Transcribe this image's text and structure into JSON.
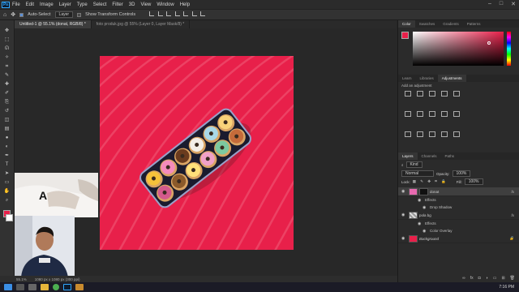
{
  "menubar": {
    "logo": "Ps",
    "items": [
      "File",
      "Edit",
      "Image",
      "Layer",
      "Type",
      "Select",
      "Filter",
      "3D",
      "View",
      "Window",
      "Help"
    ],
    "window_controls": [
      "–",
      "□",
      "✕"
    ]
  },
  "options": {
    "auto_select_label": "Auto-Select",
    "auto_select_value": "Layer",
    "transform_label": "Show Transform Controls"
  },
  "tabs": [
    {
      "label": "Untitled-1 @ 55.1% (donat, RGB/8) *",
      "active": true
    },
    {
      "label": "foto produk.jpg @ 55% (Layer 0, Layer Mask/8) *",
      "active": false
    }
  ],
  "toolbar": {
    "tools": [
      "move-icon",
      "marquee-icon",
      "lasso-icon",
      "quick-select-icon",
      "crop-icon",
      "eyedropper-icon",
      "healing-icon",
      "brush-icon",
      "stamp-icon",
      "history-brush-icon",
      "eraser-icon",
      "gradient-icon",
      "blur-icon",
      "dodge-icon",
      "pen-icon",
      "type-icon",
      "path-select-icon",
      "shape-icon",
      "hand-icon",
      "zoom-icon"
    ],
    "type_glyph": "T",
    "foreground": "#e8204a",
    "background": "#ffffff"
  },
  "canvas": {
    "bg_color": "#e8204a",
    "stripe_color": "#f05a76"
  },
  "status": {
    "zoom": "55.1%",
    "doc_info": "1080 px x 1080 px (300 ppi)"
  },
  "hint_letter": "A",
  "color_panel": {
    "tabs": [
      "Color",
      "Swatches",
      "Gradients",
      "Patterns"
    ]
  },
  "adjustments_panel": {
    "tabs": [
      "Learn",
      "Libraries",
      "Adjustments"
    ],
    "add_label": "Add an adjustment"
  },
  "layers_panel": {
    "tabs": [
      "Layers",
      "Channels",
      "Paths"
    ],
    "kind_label": "Kind",
    "blend_mode": "Normal",
    "opacity_label": "Opacity:",
    "opacity_value": "100%",
    "lock_label": "Lock:",
    "fill_label": "Fill:",
    "fill_value": "100%",
    "layers": [
      {
        "name": "donat",
        "fx": "fx",
        "effects_label": "Effects",
        "effects": [
          "Drop Shadow"
        ]
      },
      {
        "name": "pola bg",
        "fx": "fx",
        "effects_label": "Effects",
        "effects": [
          "Color Overlay"
        ]
      },
      {
        "name": "Background"
      }
    ]
  },
  "taskbar": {
    "time": "7:16 PM",
    "date": "",
    "apps": [
      "windows-icon",
      "search-icon",
      "taskview-icon",
      "explorer-icon",
      "chrome-icon",
      "photoshop-icon",
      "folder-icon"
    ]
  }
}
